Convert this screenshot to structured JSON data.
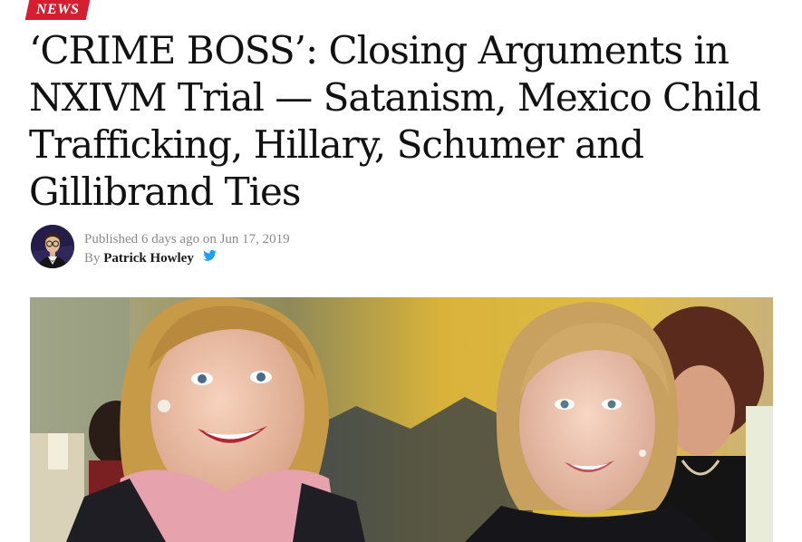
{
  "category_tag": "NEWS",
  "headline": "‘CRIME BOSS’: Closing Arguments in NXIVM Trial — Satanism, Mexico Child Trafficking, Hillary, Schumer and Gillibrand Ties",
  "byline": {
    "published_prefix": "Published",
    "relative_date": "6 days ago",
    "on_word": "on",
    "date": "Jun 17, 2019",
    "by_word": "By",
    "author": "Patrick Howley",
    "social_icon": "twitter-bird-icon"
  },
  "colors": {
    "tag_red": "#d31f31",
    "headline_text": "#111111",
    "meta_gray": "#8a8a8a",
    "twitter_blue": "#1da1f2"
  }
}
